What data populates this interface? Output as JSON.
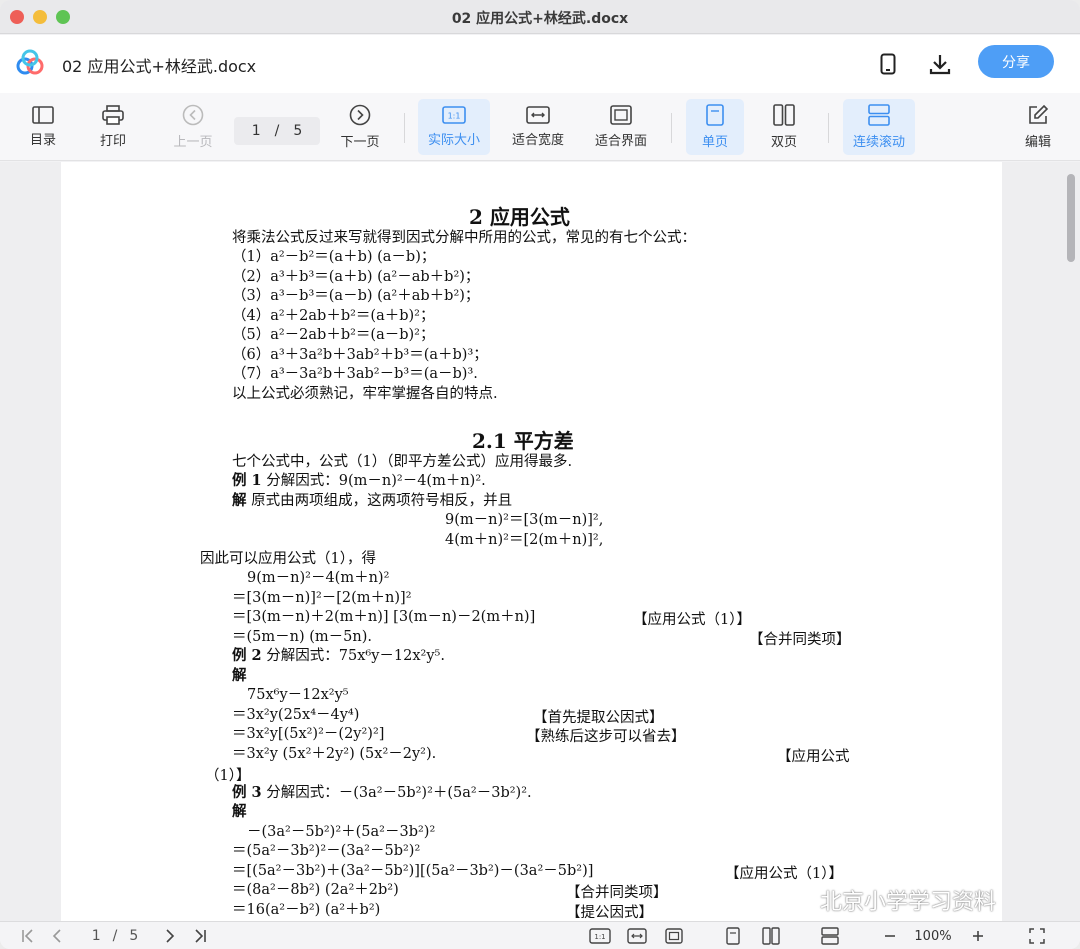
{
  "window": {
    "title": "02 应用公式+林经武.docx"
  },
  "header": {
    "doc_name": "02 应用公式+林经武.docx",
    "share_label": "分享"
  },
  "toolbar": {
    "toc": "目录",
    "print": "打印",
    "prev": "上一页",
    "page_current": "1",
    "page_sep": "/",
    "page_total": "5",
    "next": "下一页",
    "actual_size": "实际大小",
    "fit_width": "适合宽度",
    "fit_page": "适合界面",
    "single": "单页",
    "double": "双页",
    "continuous": "连续滚动",
    "edit": "编辑",
    "actual_icon_text": "1:1"
  },
  "document": {
    "title": "2 应用公式",
    "intro": "将乘法公式反过来写就得到因式分解中所用的公式，常见的有七个公式：",
    "formulas": [
      "（1）a²－b²＝(a＋b) (a－b)；",
      "（2）a³＋b³＝(a＋b) (a²－ab＋b²)；",
      "（3）a³－b³＝(a－b) (a²＋ab＋b²)；",
      "（4）a²＋2ab＋b²＝(a＋b)²；",
      "（5）a²－2ab＋b²＝(a－b)²；",
      "（6）a³＋3a²b＋3ab²＋b³＝(a＋b)³；",
      "（7）a³－3a²b＋3ab²－b³＝(a－b)³."
    ],
    "outro": "以上公式必须熟记，牢牢掌握各自的特点.",
    "section_title": "2.1 平方差",
    "section_intro": "七个公式中，公式（1）（即平方差公式）应用得最多.",
    "ex1_label": "例 1",
    "ex1_text": " 分解因式：9(m－n)²－4(m＋n)².",
    "sol_label": "解",
    "ex1_sol": " 原式由两项组成，这两项符号相反，并且",
    "ex1_eq1": "9(m－n)²＝[3(m－n)]²,",
    "ex1_eq2": "4(m＋n)²＝[2(m＋n)]²,",
    "ex1_therefore": "因此可以应用公式（1），得",
    "ex1_s1": "9(m－n)²－4(m＋n)²",
    "ex1_s2": "＝[3(m－n)]²－[2(m＋n)]²",
    "ex1_s3": "＝[3(m－n)＋2(m＋n)] [3(m－n)－2(m＋n)]",
    "ex1_s3_note": "【应用公式（1）】",
    "ex1_s4": "＝(5m－n) (m－5n).",
    "ex1_s4_note": "【合并同类项】",
    "ex2_label": "例 2",
    "ex2_text": " 分解因式：75x⁶y－12x²y⁵.",
    "ex2_s1": "75x⁶y－12x²y⁵",
    "ex2_s2": "＝3x²y(25x⁴－4y⁴)",
    "ex2_s2_note": "【首先提取公因式】",
    "ex2_s3": "＝3x²y[(5x²)²－(2y²)²]",
    "ex2_s3_note": "【熟练后这步可以省去】",
    "ex2_s4": "＝3x²y (5x²＋2y²) (5x²－2y²).",
    "ex2_s4_note_a": "【应用公式",
    "ex2_s4_note_b": "（1）】",
    "ex3_label": "例 3",
    "ex3_text": " 分解因式：－(3a²－5b²)²＋(5a²－3b²)².",
    "ex3_s1": "－(3a²－5b²)²＋(5a²－3b²)²",
    "ex3_s2": "＝(5a²－3b²)²－(3a²－5b²)²",
    "ex3_s3": "＝[(5a²－3b²)＋(3a²－5b²)][(5a²－3b²)－(3a²－5b²)]",
    "ex3_s3_note": "【应用公式（1）】",
    "ex3_s4": "＝(8a²－8b²) (2a²＋2b²)",
    "ex3_s4_note": "【合并同类项】",
    "ex3_s5": "＝16(a²－b²) (a²＋b²)",
    "ex3_s5_note": "【提公因式】"
  },
  "bottombar": {
    "page_current": "1",
    "page_sep": "/",
    "page_total": "5",
    "zoom": "100%",
    "actual_icon_text": "1:1"
  },
  "watermark": {
    "text": "北京小学学习资料"
  },
  "colors": {
    "accent": "#4e9ef6",
    "active_bg": "#e3eefc",
    "active_text": "#3d8ff0"
  }
}
